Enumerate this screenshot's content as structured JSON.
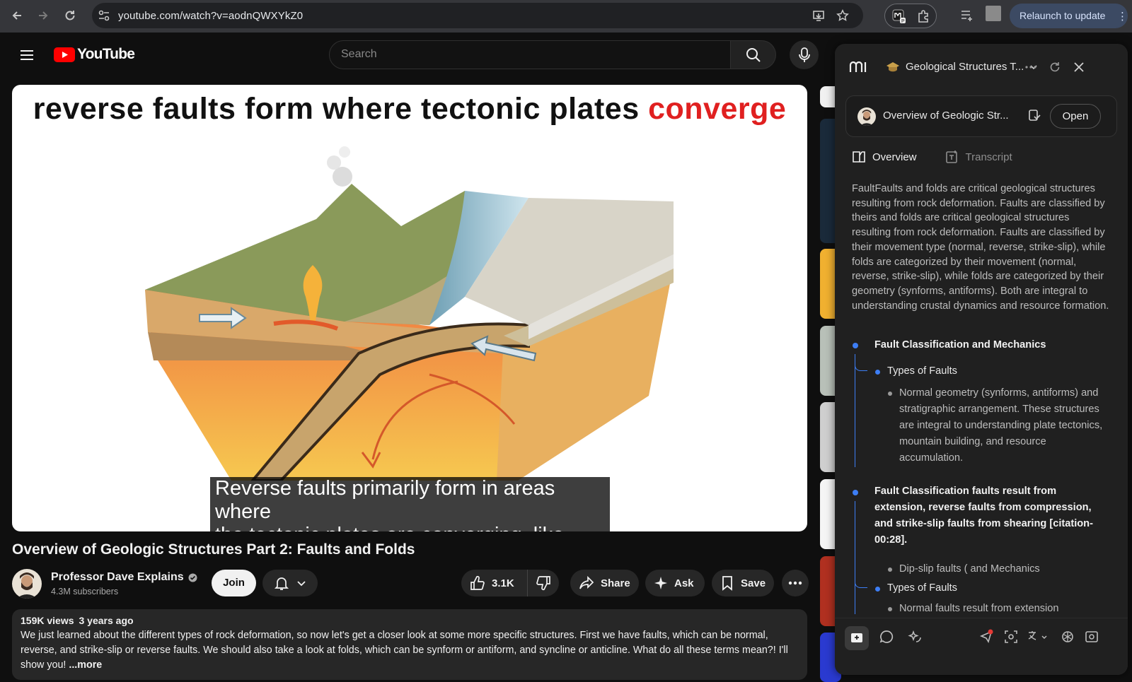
{
  "browser": {
    "url": "youtube.com/watch?v=aodnQWXYkZ0",
    "relaunch_label": "Relaunch to update"
  },
  "header": {
    "logo_text": "YouTube",
    "search_placeholder": "Search"
  },
  "player": {
    "slide_title_main": "reverse faults form where tectonic plates ",
    "slide_title_highlight": "converge",
    "caption_line1": "Reverse faults primarily form in areas where",
    "caption_line2": "the tectonic plates are converging, like along"
  },
  "video": {
    "title": "Overview of Geologic Structures Part 2: Faults and Folds",
    "channel": "Professor Dave Explains",
    "subscribers": "4.3M subscribers",
    "join_label": "Join",
    "likes": "3.1K",
    "share_label": "Share",
    "ask_label": "Ask",
    "save_label": "Save",
    "views": "159K views",
    "age": "3 years ago",
    "description": "We just learned about the different types of rock deformation, so now let's get a closer look at some more specific structures. First we have faults, which can be normal, reverse, and strike-slip or reverse faults. We should also take a look at folds, which can be synform or antiform, and syncline or anticline. What do all these terms mean?! I'll show you!",
    "more_label": "...more"
  },
  "panel": {
    "course_title": "Geological Structures T...",
    "card_title": "Overview of Geologic Str...",
    "open_label": "Open",
    "tab_overview": "Overview",
    "tab_transcript": "Transcript",
    "summary": "FaultFaults and folds are critical geological structures resulting from rock deformation. Faults are classified by theirs and folds are critical geological structures resulting from rock deformation. Faults are classified by their movement type (normal, reverse, strike-slip), while folds are categorized by their movement (normal, reverse, strike-slip), while folds are categorized by their geometry (synforms, antiforms). Both are integral to understanding crustal dynamics and resource formation.",
    "section1_title": "Fault Classification and Mechanics",
    "section1_sub": "Types of Faults",
    "section1_leaf": "Normal geometry (synforms, antiforms) and stratigraphic arrangement. These structures are integral to understanding plate tectonics, mountain building, and resource accumulation.",
    "section2_title": "Fault Classification faults result from extension, reverse faults from compression, and strike-slip faults from shearing [citation-00:28].",
    "section2_leaf": "Dip-slip faults ( and Mechanics",
    "section2_sub": "Types of Faults",
    "section2_leaf2": "Normal faults result from extension"
  },
  "colors": {
    "accent_blue": "#3d7ef5",
    "youtube_red": "#ff0000",
    "title_red": "#e02020"
  }
}
